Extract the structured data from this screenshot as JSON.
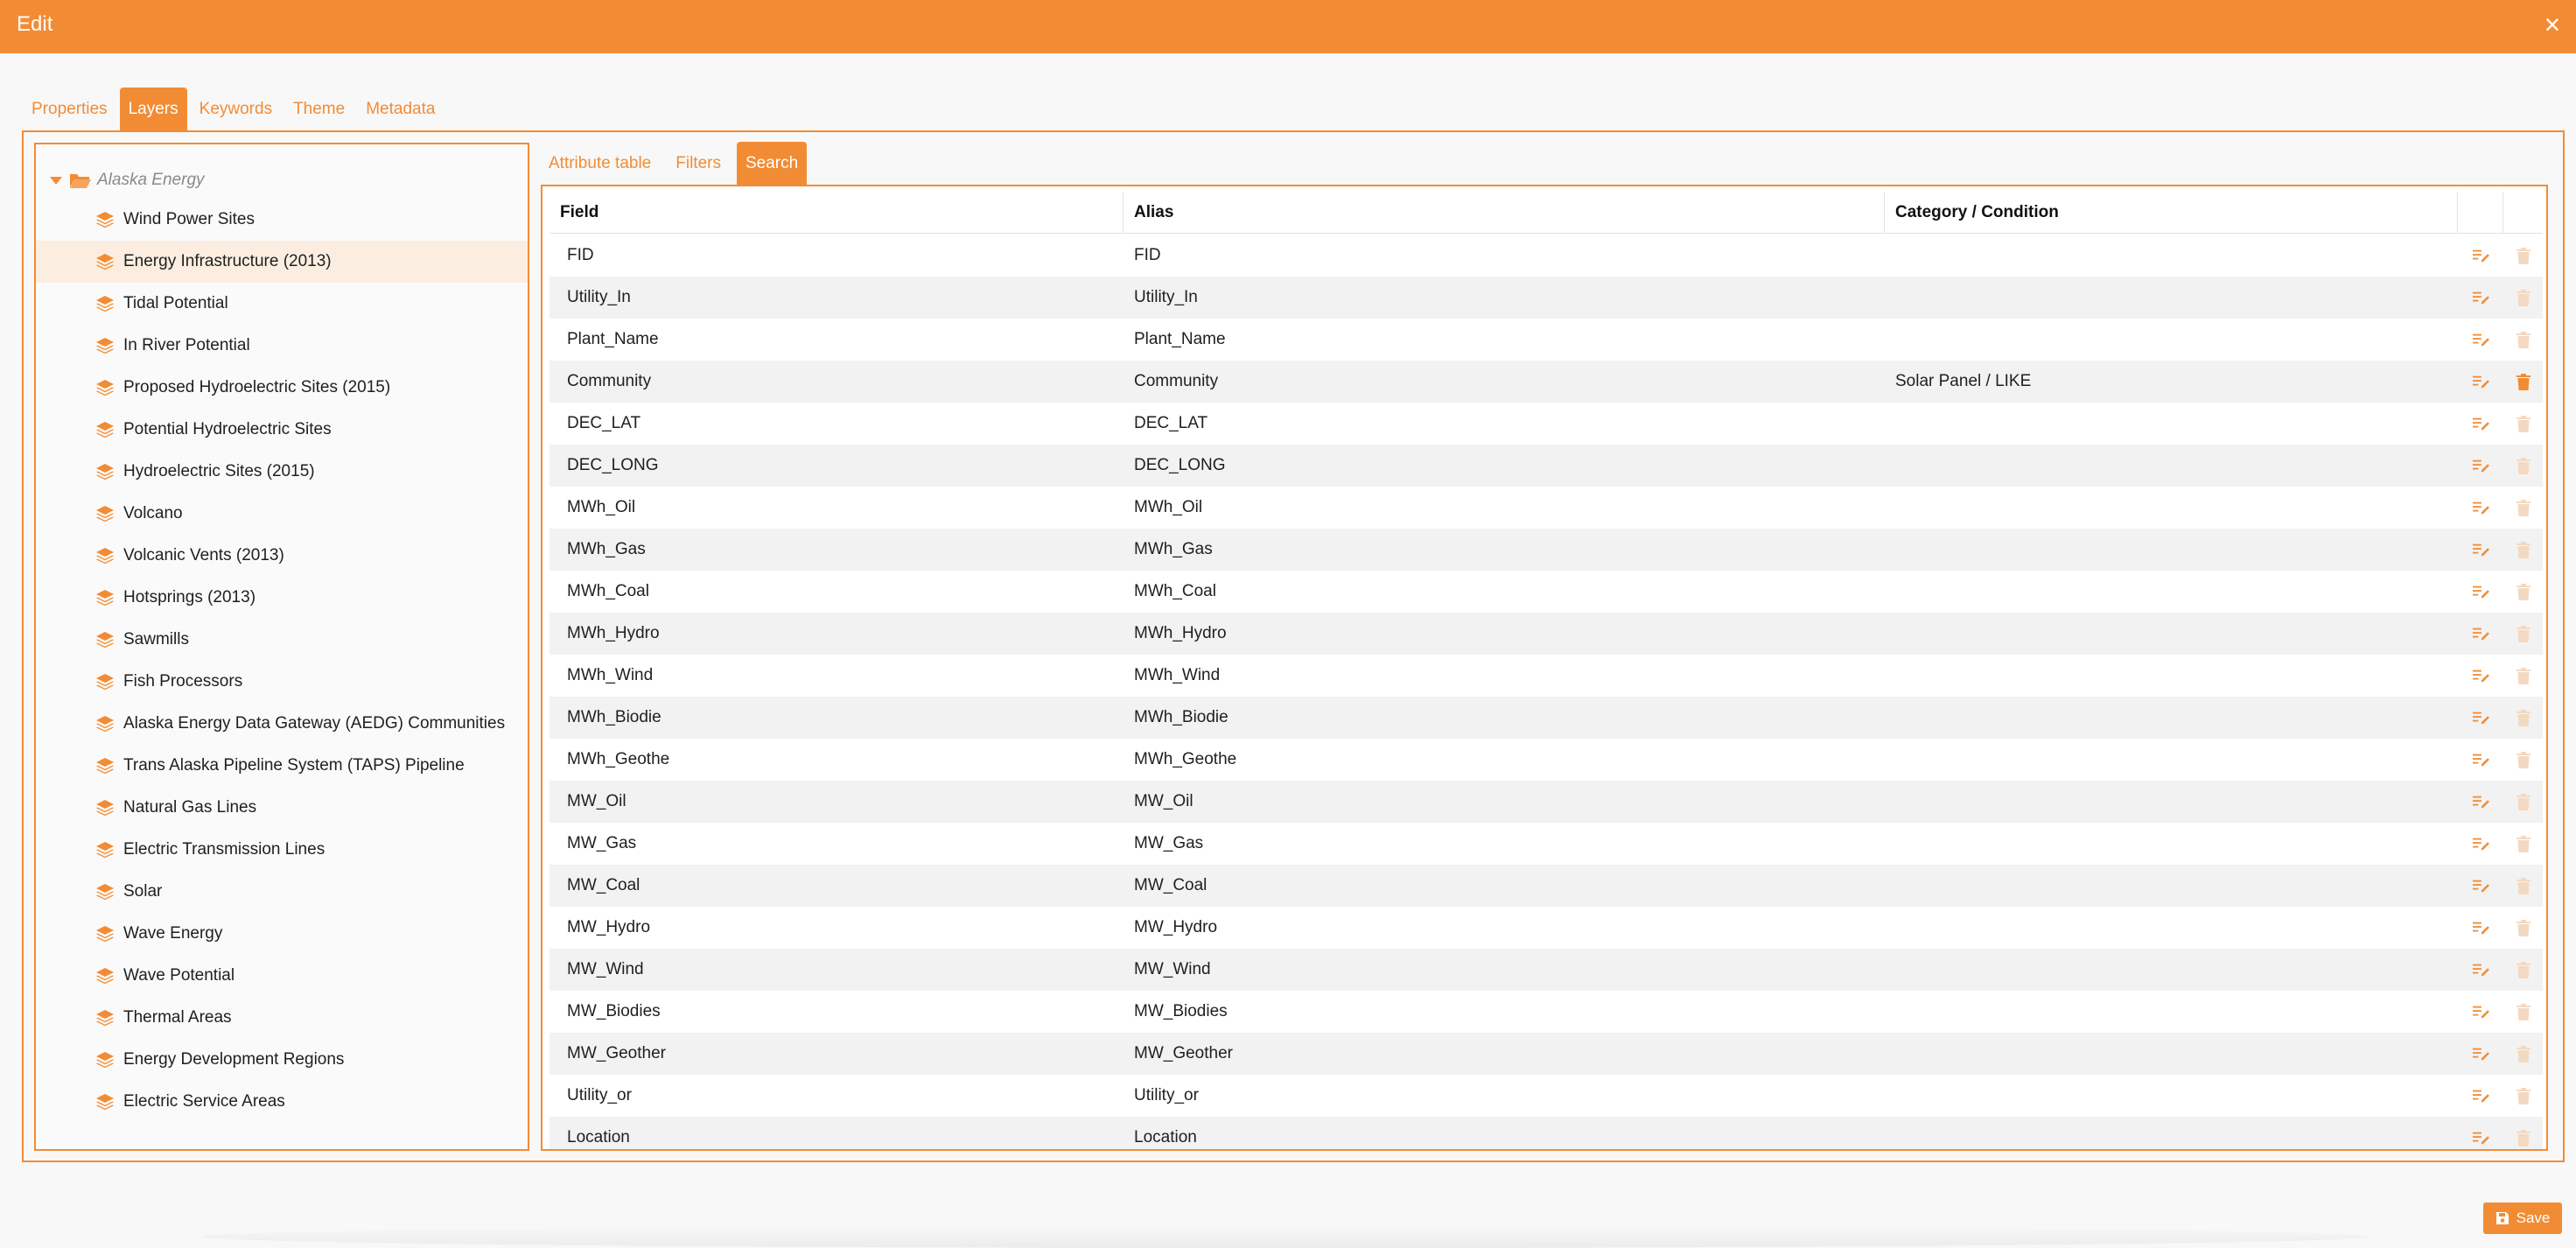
{
  "dialog": {
    "title": "Edit",
    "close_symbol": "×",
    "accent_color": "#f28c34"
  },
  "top_tabs": [
    {
      "label": "Properties",
      "active": false
    },
    {
      "label": "Layers",
      "active": true
    },
    {
      "label": "Keywords",
      "active": false
    },
    {
      "label": "Theme",
      "active": false
    },
    {
      "label": "Metadata",
      "active": false
    }
  ],
  "tree": {
    "root_label": "Alaska Energy",
    "root_icon": "folder-open-icon",
    "item_icon": "layers-icon",
    "items": [
      {
        "label": "Wind Power Sites",
        "selected": false
      },
      {
        "label": "Energy Infrastructure (2013)",
        "selected": true
      },
      {
        "label": "Tidal Potential",
        "selected": false
      },
      {
        "label": "In River Potential",
        "selected": false
      },
      {
        "label": "Proposed Hydroelectric Sites (2015)",
        "selected": false
      },
      {
        "label": "Potential Hydroelectric Sites",
        "selected": false
      },
      {
        "label": "Hydroelectric Sites (2015)",
        "selected": false
      },
      {
        "label": "Volcano",
        "selected": false
      },
      {
        "label": "Volcanic Vents (2013)",
        "selected": false
      },
      {
        "label": "Hotsprings (2013)",
        "selected": false
      },
      {
        "label": "Sawmills",
        "selected": false
      },
      {
        "label": "Fish Processors",
        "selected": false
      },
      {
        "label": "Alaska Energy Data Gateway (AEDG) Communities",
        "selected": false
      },
      {
        "label": "Trans Alaska Pipeline System (TAPS) Pipeline",
        "selected": false
      },
      {
        "label": "Natural Gas Lines",
        "selected": false
      },
      {
        "label": "Electric Transmission Lines",
        "selected": false
      },
      {
        "label": "Solar",
        "selected": false
      },
      {
        "label": "Wave Energy",
        "selected": false
      },
      {
        "label": "Wave Potential",
        "selected": false
      },
      {
        "label": "Thermal Areas",
        "selected": false
      },
      {
        "label": "Energy Development Regions",
        "selected": false
      },
      {
        "label": "Electric Service Areas",
        "selected": false
      }
    ]
  },
  "sub_tabs": [
    {
      "label": "Attribute table",
      "active": false
    },
    {
      "label": "Filters",
      "active": false
    },
    {
      "label": "Search",
      "active": true
    }
  ],
  "table": {
    "headers": {
      "field": "Field",
      "alias": "Alias",
      "category": "Category / Condition"
    },
    "rows": [
      {
        "field": "FID",
        "alias": "FID",
        "category": "",
        "delete_enabled": false
      },
      {
        "field": "Utility_In",
        "alias": "Utility_In",
        "category": "",
        "delete_enabled": false
      },
      {
        "field": "Plant_Name",
        "alias": "Plant_Name",
        "category": "",
        "delete_enabled": false
      },
      {
        "field": "Community",
        "alias": "Community",
        "category": "Solar Panel / LIKE",
        "delete_enabled": true
      },
      {
        "field": "DEC_LAT",
        "alias": "DEC_LAT",
        "category": "",
        "delete_enabled": false
      },
      {
        "field": "DEC_LONG",
        "alias": "DEC_LONG",
        "category": "",
        "delete_enabled": false
      },
      {
        "field": "MWh_Oil",
        "alias": "MWh_Oil",
        "category": "",
        "delete_enabled": false
      },
      {
        "field": "MWh_Gas",
        "alias": "MWh_Gas",
        "category": "",
        "delete_enabled": false
      },
      {
        "field": "MWh_Coal",
        "alias": "MWh_Coal",
        "category": "",
        "delete_enabled": false
      },
      {
        "field": "MWh_Hydro",
        "alias": "MWh_Hydro",
        "category": "",
        "delete_enabled": false
      },
      {
        "field": "MWh_Wind",
        "alias": "MWh_Wind",
        "category": "",
        "delete_enabled": false
      },
      {
        "field": "MWh_Biodie",
        "alias": "MWh_Biodie",
        "category": "",
        "delete_enabled": false
      },
      {
        "field": "MWh_Geothe",
        "alias": "MWh_Geothe",
        "category": "",
        "delete_enabled": false
      },
      {
        "field": "MW_Oil",
        "alias": "MW_Oil",
        "category": "",
        "delete_enabled": false
      },
      {
        "field": "MW_Gas",
        "alias": "MW_Gas",
        "category": "",
        "delete_enabled": false
      },
      {
        "field": "MW_Coal",
        "alias": "MW_Coal",
        "category": "",
        "delete_enabled": false
      },
      {
        "field": "MW_Hydro",
        "alias": "MW_Hydro",
        "category": "",
        "delete_enabled": false
      },
      {
        "field": "MW_Wind",
        "alias": "MW_Wind",
        "category": "",
        "delete_enabled": false
      },
      {
        "field": "MW_Biodies",
        "alias": "MW_Biodies",
        "category": "",
        "delete_enabled": false
      },
      {
        "field": "MW_Geother",
        "alias": "MW_Geother",
        "category": "",
        "delete_enabled": false
      },
      {
        "field": "Utility_or",
        "alias": "Utility_or",
        "category": "",
        "delete_enabled": false
      },
      {
        "field": "Location",
        "alias": "Location",
        "category": "",
        "delete_enabled": false
      }
    ]
  },
  "footer": {
    "save_label": "Save",
    "save_icon": "floppy-disk-icon"
  }
}
